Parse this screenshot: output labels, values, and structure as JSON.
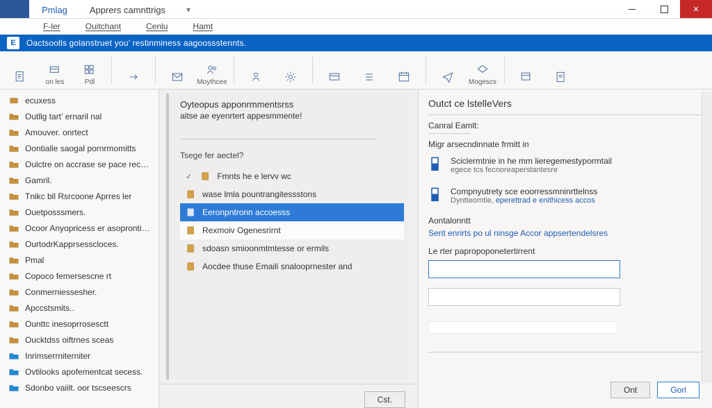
{
  "titlebar": {
    "tab_active": "Pmlag",
    "tab_secondary": "Apprers camnttrigs",
    "arrow": "▾"
  },
  "menubar": {
    "items": [
      "F-ler",
      "Ouitchant",
      "Cenlu",
      "Hamt"
    ]
  },
  "ribbon": {
    "msg": "Oactsoolls golanstruet you’ restinminess aagoossstennts."
  },
  "toolbar": {
    "groups": [
      [
        "",
        "on les",
        "Pdl"
      ],
      [
        ""
      ],
      [
        "",
        "Moythcee"
      ],
      [
        "",
        ""
      ],
      [
        "",
        "",
        ""
      ],
      [
        "",
        "Mogescs"
      ],
      [
        "",
        ""
      ]
    ]
  },
  "left_nav": [
    {
      "icon": "box",
      "label": "ecuxess"
    },
    {
      "icon": "folder",
      "label": "Outllg tart’ ernaril nal"
    },
    {
      "icon": "folder",
      "label": "Amouver. onrtect"
    },
    {
      "icon": "folder",
      "label": "Oontialle saogal pornrmomitts"
    },
    {
      "icon": "folder",
      "label": "Oulctre on accrase se pace recess."
    },
    {
      "icon": "folder",
      "label": "Gamril."
    },
    {
      "icon": "folder",
      "label": "Tnikc bll Rsrcoone Aprres ler"
    },
    {
      "icon": "folder",
      "label": "Ouetposssmers."
    },
    {
      "icon": "folder",
      "label": "Ocoor Anyopricess er asoprontime srnnte"
    },
    {
      "icon": "folder",
      "label": "OurtodrKapprsesscloces."
    },
    {
      "icon": "folder",
      "label": "Pmal"
    },
    {
      "icon": "folder",
      "label": "Copoco femersescne rt"
    },
    {
      "icon": "folder",
      "label": "Conmerniessesher."
    },
    {
      "icon": "folder",
      "label": "Apccstsmits.."
    },
    {
      "icon": "folder",
      "label": "Ounttc inesoprrosesctt"
    },
    {
      "icon": "folder",
      "label": "Oucktdss oiftrnes sceas"
    },
    {
      "icon": "blue",
      "label": "Inrimserrniterniter"
    },
    {
      "icon": "blue",
      "label": "Ovtilooks apofementcat secess."
    },
    {
      "icon": "blue",
      "label": "Sdonbo vaiilt. oor tscseescrs"
    }
  ],
  "mid": {
    "title": "Oyteopus apponrmmentsrss",
    "sub": "aitse ae eyenrtert appesmmente!",
    "sec_label": "Tsege fer aectel?",
    "items": [
      {
        "kind": "check",
        "label": "Fmnts he e  lervv wc"
      },
      {
        "kind": "plain",
        "label": "wase lmla pountrangitessstons"
      },
      {
        "kind": "sel",
        "label": "Eeronpntronn accoesss"
      },
      {
        "kind": "alt",
        "label": "Rexmoiv Ogenesrirnt"
      },
      {
        "kind": "plain",
        "label": "sdoasn smioonmtmtesse or ermils"
      },
      {
        "kind": "plain",
        "label": "Aocdee thuse Emaili snalooprnester and"
      }
    ],
    "btn": "Cst."
  },
  "right": {
    "title": "Outct ce lstelleVers",
    "sub1": "Canral Eamlt:",
    "sub2": "Migr arsecndinnate frmitt  in",
    "block1_l1": "Sciclermtnie in he  mm lieregemestypormtail",
    "block1_l2": "egece tcs fecnoreaperstantesre",
    "block2_l1": "Compnyutrety sce eoorressmninrttelnss",
    "block2_l2a": "Dyntteomtie, ",
    "block2_l2b": "eperettrad e enithicess accos",
    "heading3": "Aontalonntt",
    "link3": "Serit enrirts po ul ninsge Accor appsertendelsres",
    "field_label": "Le rter papropoponetertirrent",
    "btn_cancel": "Ont",
    "btn_ok": "Gorl"
  }
}
